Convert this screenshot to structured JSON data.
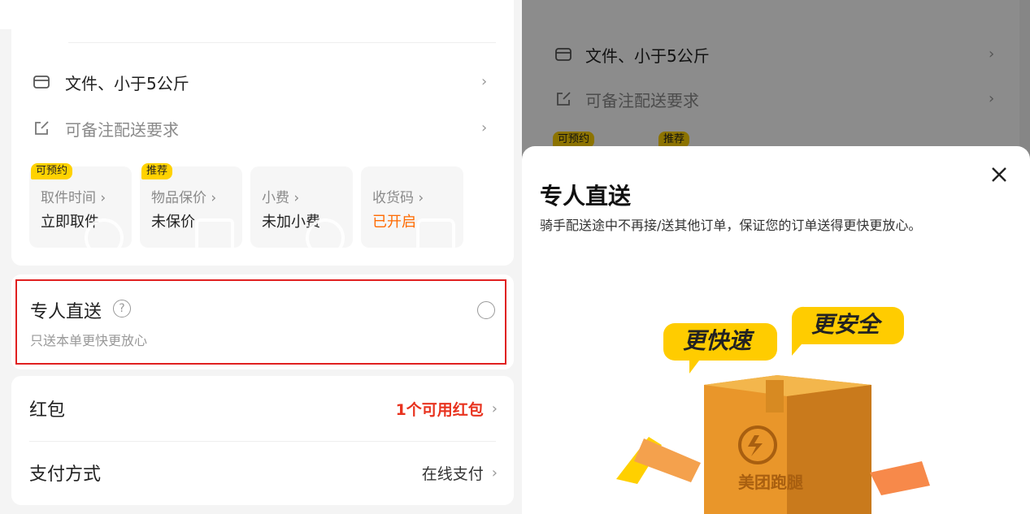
{
  "left": {
    "item_type": "文件、小于5公斤",
    "remark": "可备注配送要求",
    "options": [
      {
        "tag": "可预约",
        "label": "取件时间 ›",
        "value": "立即取件",
        "icon": "clock-icon"
      },
      {
        "tag": "推荐",
        "label": "物品保价 ›",
        "value": "未保价",
        "icon": "check-icon"
      },
      {
        "tag": "",
        "label": "小费 ›",
        "value": "未加小费",
        "icon": "yen-icon"
      },
      {
        "tag": "",
        "label": "收货码 ›",
        "value": "已开启",
        "icon": "lock-icon"
      }
    ],
    "direct": {
      "title": "专人直送",
      "subtitle": "只送本单更快更放心"
    },
    "coupon": {
      "label": "红包",
      "value": "1个可用红包"
    },
    "payment": {
      "label": "支付方式",
      "value": "在线支付"
    }
  },
  "right": {
    "item_type": "文件、小于5公斤",
    "remark": "可备注配送要求",
    "tags": [
      "可预约",
      "推荐"
    ],
    "sheet": {
      "title": "专人直送",
      "desc": "骑手配送途中不再接/送其他订单，保证您的订单送得更快更放心。",
      "bubble_fast": "更快速",
      "bubble_safe": "更安全",
      "box_brand": "美团跑腿"
    }
  },
  "colors": {
    "accent": "#ffd200",
    "red": "#e8331f",
    "orange": "#ff6a00",
    "highlight_border": "#e02020"
  }
}
